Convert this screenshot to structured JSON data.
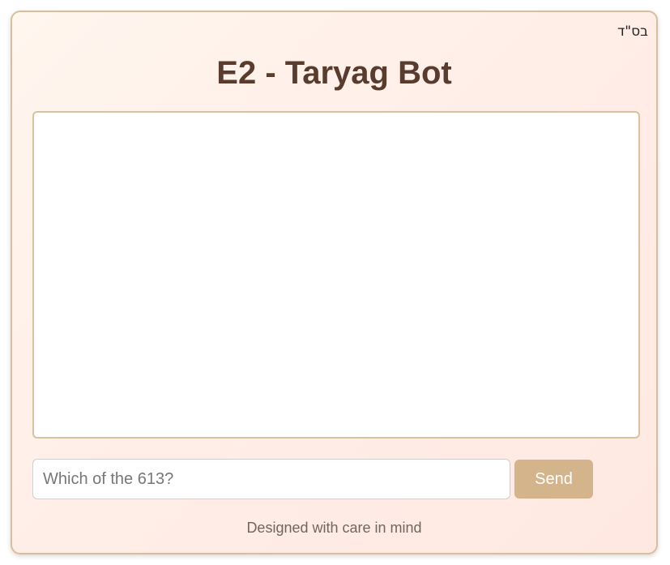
{
  "header": {
    "bsd": "בס\"ד",
    "title": "E2 - Taryag Bot"
  },
  "chat": {
    "messages": []
  },
  "composer": {
    "placeholder": "Which of the 613?",
    "value": "",
    "send_label": "Send"
  },
  "footer": {
    "text": "Designed with care in mind"
  },
  "colors": {
    "accent": "#d4b58b",
    "title": "#5a3c2e",
    "border": "#d6bf9f"
  }
}
